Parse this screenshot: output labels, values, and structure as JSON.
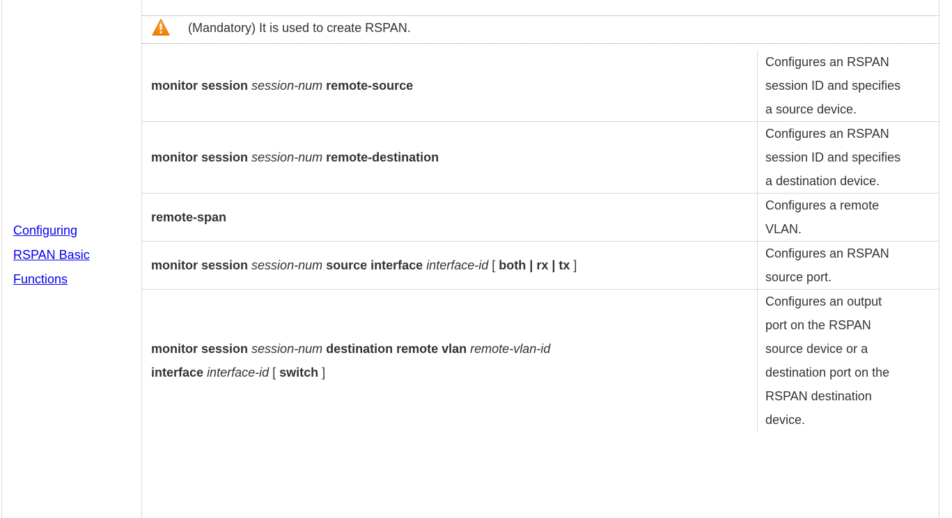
{
  "left_cell": {
    "link_line1": "Configuring ",
    "link_line2": "RSPAN Basic ",
    "link_line3": "Functions"
  },
  "caution": {
    "icon": "warning-triangle-icon",
    "text": "(Mandatory) It is used to create RSPAN."
  },
  "rows": [
    {
      "cmd": [
        {
          "t": "monitor session",
          "s": "b"
        },
        {
          "t": " ",
          "s": ""
        },
        {
          "t": "session-num",
          "s": "i"
        },
        {
          "t": " ",
          "s": ""
        },
        {
          "t": "remote-source",
          "s": "b"
        }
      ],
      "desc_lines": [
        "Configures an RSPAN",
        "session ID and specifies",
        "a source device."
      ]
    },
    {
      "cmd": [
        {
          "t": "monitor session",
          "s": "b"
        },
        {
          "t": " ",
          "s": ""
        },
        {
          "t": "session-num",
          "s": "i"
        },
        {
          "t": " ",
          "s": ""
        },
        {
          "t": "remote-destination",
          "s": "b"
        }
      ],
      "desc_lines": [
        "Configures an RSPAN",
        "session ID and specifies",
        "a destination device."
      ]
    },
    {
      "cmd": [
        {
          "t": "remote-span",
          "s": "b"
        }
      ],
      "desc_lines": [
        "Configures a remote",
        "VLAN."
      ]
    },
    {
      "cmd": [
        {
          "t": "monitor session",
          "s": "b"
        },
        {
          "t": " ",
          "s": ""
        },
        {
          "t": "session-num",
          "s": "i"
        },
        {
          "t": " ",
          "s": ""
        },
        {
          "t": "source interface",
          "s": "b"
        },
        {
          "t": " ",
          "s": ""
        },
        {
          "t": "interface-id",
          "s": "i"
        },
        {
          "t": " [ ",
          "s": ""
        },
        {
          "t": "both",
          "s": "b"
        },
        {
          "t": " ",
          "s": ""
        },
        {
          "t": "|",
          "s": "b"
        },
        {
          "t": " ",
          "s": ""
        },
        {
          "t": "rx",
          "s": "b"
        },
        {
          "t": " ",
          "s": ""
        },
        {
          "t": "|",
          "s": "b"
        },
        {
          "t": " ",
          "s": ""
        },
        {
          "t": "tx",
          "s": "b"
        },
        {
          "t": " ]",
          "s": ""
        }
      ],
      "desc_lines": [
        "Configures an RSPAN",
        "source port."
      ]
    },
    {
      "cmd": [
        {
          "t": "monitor session",
          "s": "b"
        },
        {
          "t": " ",
          "s": ""
        },
        {
          "t": "session-num",
          "s": "i"
        },
        {
          "t": " ",
          "s": ""
        },
        {
          "t": "destination remote vlan",
          "s": "b"
        },
        {
          "t": " ",
          "s": ""
        },
        {
          "t": "remote-vlan-id",
          "s": "i"
        },
        {
          "t": "\n",
          "s": "br"
        },
        {
          "t": "interface",
          "s": "b"
        },
        {
          "t": " ",
          "s": ""
        },
        {
          "t": "interface-id",
          "s": "i"
        },
        {
          "t": " [ ",
          "s": ""
        },
        {
          "t": "switch",
          "s": "b"
        },
        {
          "t": " ]",
          "s": ""
        }
      ],
      "desc_lines": [
        "Configures an output",
        "port on the RSPAN",
        "source device or a",
        "destination port on the",
        "RSPAN destination",
        "device."
      ]
    }
  ]
}
